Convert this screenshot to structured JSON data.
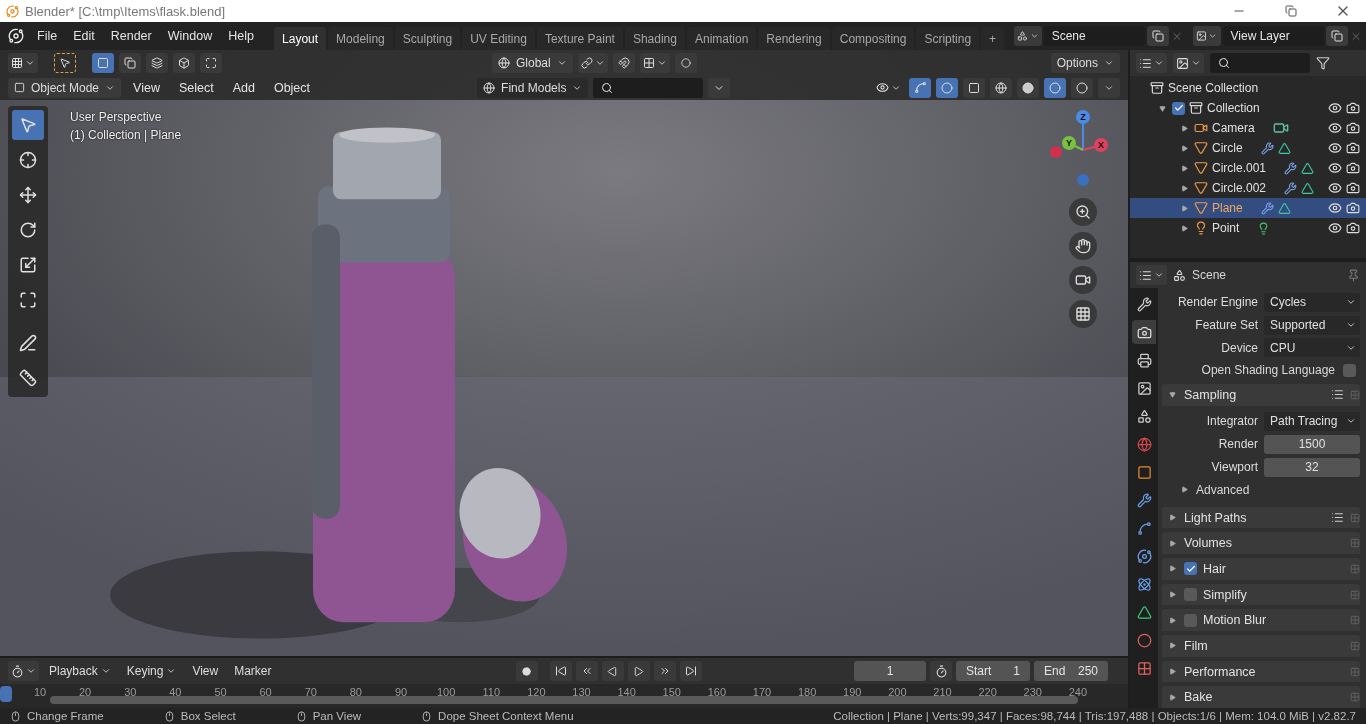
{
  "window": {
    "title": "Blender* [C:\\tmp\\Items\\flask.blend]"
  },
  "menu": [
    "File",
    "Edit",
    "Render",
    "Window",
    "Help"
  ],
  "workspaces": [
    {
      "label": "Layout",
      "selected": true
    },
    {
      "label": "Modeling",
      "selected": false
    },
    {
      "label": "Sculpting",
      "selected": false
    },
    {
      "label": "UV Editing",
      "selected": false
    },
    {
      "label": "Texture Paint",
      "selected": false
    },
    {
      "label": "Shading",
      "selected": false
    },
    {
      "label": "Animation",
      "selected": false
    },
    {
      "label": "Rendering",
      "selected": false
    },
    {
      "label": "Compositing",
      "selected": false
    },
    {
      "label": "Scripting",
      "selected": false
    },
    {
      "label": "+",
      "selected": false
    }
  ],
  "scene_field": {
    "value": "Scene"
  },
  "view_layer_field": {
    "value": "View Layer"
  },
  "viewport": {
    "select_modes": [
      {
        "selected": true
      },
      {
        "selected": false
      },
      {
        "selected": false
      },
      {
        "selected": false
      },
      {
        "selected": false
      }
    ],
    "orientation": "Global",
    "options": "Options",
    "mode": "Object Mode",
    "header_menu": [
      "View",
      "Select",
      "Add",
      "Object"
    ],
    "find_models": "Find Models",
    "shading": [
      {
        "selected": false
      },
      {
        "selected": false
      },
      {
        "selected": true
      },
      {
        "selected": false
      }
    ],
    "overlay_lines": [
      "User Perspective",
      "(1) Collection | Plane"
    ],
    "gizmo_axes": [
      "Z",
      "Y",
      "X"
    ],
    "tools": [
      {
        "kind": "select",
        "selected": true
      },
      {
        "kind": "cursor",
        "selected": false
      },
      {
        "kind": "move",
        "selected": false
      },
      {
        "kind": "rotate",
        "selected": false
      },
      {
        "kind": "scale",
        "selected": false
      },
      {
        "kind": "transform",
        "selected": false
      },
      {
        "kind": "annotate",
        "selected": false
      },
      {
        "kind": "measure",
        "selected": false
      }
    ]
  },
  "outliner": {
    "root": "Scene Collection",
    "items": [
      {
        "label": "Collection",
        "kind": "collection",
        "checked": true,
        "expanded": true,
        "selected": false,
        "children": [
          {
            "label": "Camera",
            "kind": "camera",
            "expanded": false,
            "selected": false
          },
          {
            "label": "Circle",
            "kind": "mesh",
            "expanded": false,
            "selected": false
          },
          {
            "label": "Circle.001",
            "kind": "mesh",
            "expanded": false,
            "selected": false
          },
          {
            "label": "Circle.002",
            "kind": "mesh",
            "expanded": false,
            "selected": false
          },
          {
            "label": "Plane",
            "kind": "mesh",
            "expanded": false,
            "selected": true
          },
          {
            "label": "Point",
            "kind": "light",
            "expanded": false,
            "selected": false
          }
        ]
      }
    ]
  },
  "properties": {
    "context": "Scene",
    "tabs": [
      {
        "kind": "tool",
        "selected": false
      },
      {
        "kind": "render",
        "selected": true
      },
      {
        "kind": "output",
        "selected": false
      },
      {
        "kind": "view_layer",
        "selected": false
      },
      {
        "kind": "scene",
        "selected": false
      },
      {
        "kind": "world",
        "selected": false
      },
      {
        "kind": "object",
        "selected": false
      },
      {
        "kind": "modifiers",
        "selected": false
      },
      {
        "kind": "particles",
        "selected": false
      },
      {
        "kind": "physics",
        "selected": false
      },
      {
        "kind": "constraints",
        "selected": false
      },
      {
        "kind": "data",
        "selected": false
      },
      {
        "kind": "material",
        "selected": false
      },
      {
        "kind": "texture",
        "selected": false
      }
    ],
    "fields": [
      {
        "kind": "dropdown",
        "label": "Render Engine",
        "value": "Cycles"
      },
      {
        "kind": "dropdown",
        "label": "Feature Set",
        "value": "Supported"
      },
      {
        "kind": "dropdown",
        "label": "Device",
        "value": "CPU"
      },
      {
        "kind": "checkbox",
        "label": "Open Shading Language",
        "checked": false
      }
    ],
    "panels": [
      {
        "label": "Sampling",
        "expanded": true,
        "presets": true,
        "fields": [
          {
            "kind": "dropdown",
            "label": "Integrator",
            "value": "Path Tracing"
          },
          {
            "kind": "number",
            "label": "Render",
            "value": "1500"
          },
          {
            "kind": "number",
            "label": "Viewport",
            "value": "32"
          }
        ],
        "subpanels": [
          {
            "label": "Advanced",
            "expanded": false
          }
        ]
      },
      {
        "label": "Light Paths",
        "expanded": false,
        "presets": true
      },
      {
        "label": "Volumes",
        "expanded": false,
        "presets": false
      },
      {
        "label": "Hair",
        "expanded": false,
        "presets": false,
        "checked": true
      },
      {
        "label": "Simplify",
        "expanded": false,
        "presets": false,
        "checked": false
      },
      {
        "label": "Motion Blur",
        "expanded": false,
        "presets": false,
        "checked": false
      },
      {
        "label": "Film",
        "expanded": false,
        "presets": false
      },
      {
        "label": "Performance",
        "expanded": false,
        "presets": false
      },
      {
        "label": "Bake",
        "expanded": false,
        "presets": false
      }
    ]
  },
  "timeline": {
    "menu": [
      "Playback",
      "Keying",
      "View",
      "Marker"
    ],
    "current_frame": "1",
    "start_label": "Start",
    "start": "1",
    "end_label": "End",
    "end": "250",
    "ticks": [
      "10",
      "20",
      "30",
      "40",
      "50",
      "60",
      "70",
      "80",
      "90",
      "100",
      "110",
      "120",
      "130",
      "140",
      "150",
      "160",
      "170",
      "180",
      "190",
      "200",
      "210",
      "220",
      "230",
      "240"
    ]
  },
  "status_bar": {
    "hints": [
      "Change Frame",
      "Box Select",
      "Pan View",
      "Dope Sheet Context Menu"
    ],
    "stats": "Collection | Plane | Verts:99,347 | Faces:98,744 | Tris:197,488 | Objects:1/6 | Mem: 104.0 MiB | v2.82.7"
  }
}
